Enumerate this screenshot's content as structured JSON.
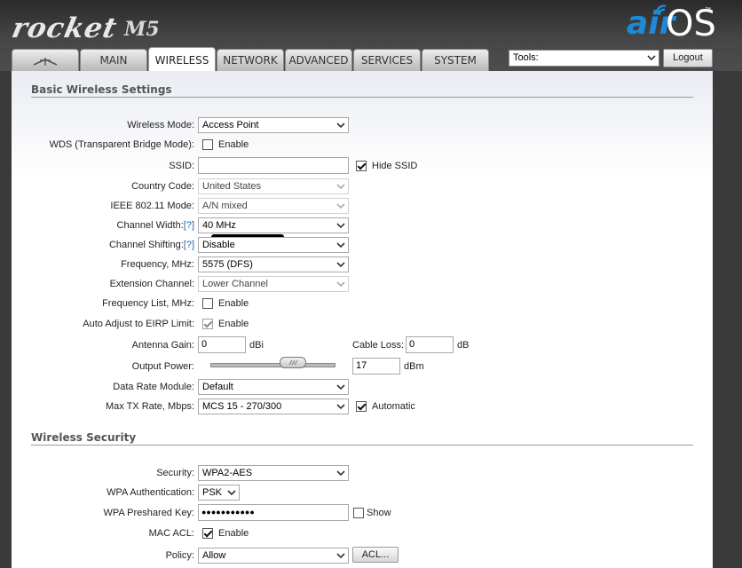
{
  "brand": {
    "product": "rocket",
    "model": "M5",
    "os_air": "air",
    "os_name": "OS",
    "tm": "™"
  },
  "tabs": [
    {
      "label": "",
      "icon": "ubiquiti-logo-icon"
    },
    {
      "label": "MAIN"
    },
    {
      "label": "WIRELESS",
      "active": true
    },
    {
      "label": "NETWORK"
    },
    {
      "label": "ADVANCED"
    },
    {
      "label": "SERVICES"
    },
    {
      "label": "SYSTEM"
    }
  ],
  "toolbar": {
    "tools_value": "Tools:",
    "logout_label": "Logout"
  },
  "basic": {
    "title": "Basic Wireless Settings",
    "wireless_mode": {
      "label": "Wireless Mode:",
      "value": "Access Point"
    },
    "wds": {
      "label": "WDS (Transparent Bridge Mode):",
      "checkbox_label": "Enable",
      "checked": false
    },
    "ssid": {
      "label": "SSID:",
      "hide_label": "Hide SSID",
      "hide_checked": true
    },
    "country": {
      "label": "Country Code:",
      "value": "United States"
    },
    "ieee_mode": {
      "label": "IEEE 802.11 Mode:",
      "value": "A/N mixed"
    },
    "channel_width": {
      "label": "Channel Width:",
      "help": "[?]",
      "value": "40 MHz"
    },
    "channel_shifting": {
      "label": "Channel Shifting:",
      "help": "[?]",
      "value": "Disable"
    },
    "frequency": {
      "label": "Frequency, MHz:",
      "value": "5575 (DFS)"
    },
    "extension": {
      "label": "Extension Channel:",
      "value": "Lower Channel"
    },
    "freq_list": {
      "label": "Frequency List, MHz:",
      "checkbox_label": "Enable",
      "checked": false
    },
    "auto_eirp": {
      "label": "Auto Adjust to EIRP Limit:",
      "checkbox_label": "Enable",
      "checked": true
    },
    "antenna_gain": {
      "label": "Antenna Gain:",
      "value": "0",
      "unit": "dBi"
    },
    "cable_loss": {
      "label": "Cable Loss:",
      "value": "0",
      "unit": "dB"
    },
    "output_power": {
      "label": "Output Power:",
      "value": "17",
      "unit": "dBm"
    },
    "data_rate": {
      "label": "Data Rate Module:",
      "value": "Default"
    },
    "max_tx": {
      "label": "Max TX Rate, Mbps:",
      "value": "MCS 15 - 270/300",
      "auto_label": "Automatic",
      "auto_checked": true
    }
  },
  "security": {
    "title": "Wireless Security",
    "security": {
      "label": "Security:",
      "value": "WPA2-AES"
    },
    "wpa_auth": {
      "label": "WPA Authentication:",
      "value": "PSK"
    },
    "psk": {
      "label": "WPA Preshared Key:",
      "value": "●●●●●●●●●●●",
      "show_label": "Show"
    },
    "mac_acl": {
      "label": "MAC ACL:",
      "checkbox_label": "Enable",
      "checked": true
    },
    "policy": {
      "label": "Policy:",
      "value": "Allow",
      "acl_button": "ACL..."
    }
  }
}
